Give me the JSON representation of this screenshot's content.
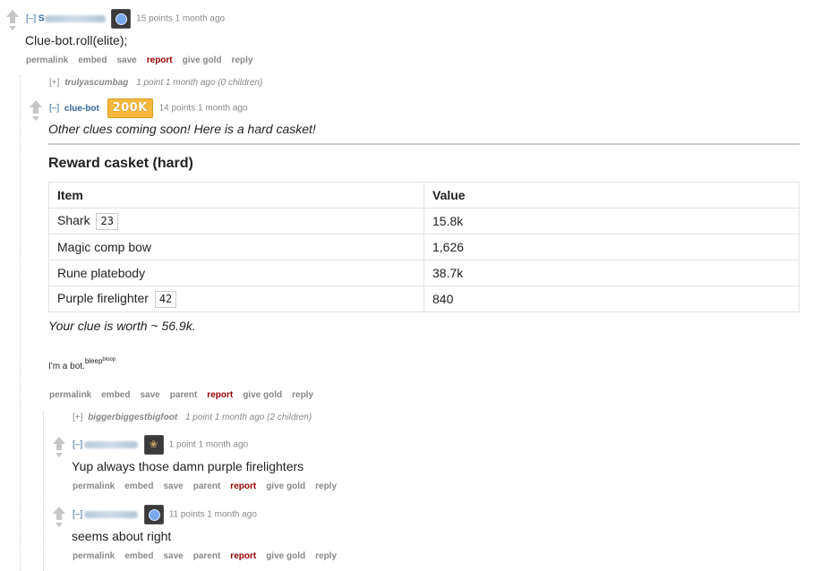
{
  "comment1": {
    "toggle": "[–]",
    "author_initial": "S",
    "score_time": "15 points 1 month ago",
    "body": "Clue-bot.roll(elite);",
    "buttons": [
      "permalink",
      "embed",
      "save",
      "report",
      "give gold",
      "reply"
    ]
  },
  "collapsed1": {
    "toggle": "[+]",
    "author": "trulyascumbag",
    "meta": "1 point 1 month ago (0 children)"
  },
  "cluebot": {
    "toggle": "[–]",
    "author": "clue-bot",
    "badge": "200K",
    "score_time": "14 points 1 month ago",
    "intro": "Other clues coming soon! Here is a hard casket!",
    "heading": "Reward casket (hard)",
    "table": {
      "headers": [
        "Item",
        "Value"
      ],
      "rows": [
        {
          "item": "Shark",
          "qty": "23",
          "value": "15.8k"
        },
        {
          "item": "Magic comp bow",
          "qty": "",
          "value": "1,626"
        },
        {
          "item": "Rune platebody",
          "qty": "",
          "value": "38.7k"
        },
        {
          "item": "Purple firelighter",
          "qty": "42",
          "value": "840"
        }
      ]
    },
    "worth": "Your clue is worth ~ 56.9k.",
    "footer_main": "I'm a bot.",
    "footer_sup1": "bleep",
    "footer_sup2": "bloop",
    "buttons": [
      "permalink",
      "embed",
      "save",
      "parent",
      "report",
      "give gold",
      "reply"
    ]
  },
  "collapsed2": {
    "toggle": "[+]",
    "author": "biggerbiggestbigfoot",
    "meta": "1 point 1 month ago (2 children)"
  },
  "reply1": {
    "toggle": "[–]",
    "score_time": "1 point 1 month ago",
    "body": "Yup always those damn purple firelighters",
    "buttons": [
      "permalink",
      "embed",
      "save",
      "parent",
      "report",
      "give gold",
      "reply"
    ]
  },
  "reply2": {
    "toggle": "[–]",
    "score_time": "11 points 1 month ago",
    "body": "seems about right",
    "buttons": [
      "permalink",
      "embed",
      "save",
      "parent",
      "report",
      "give gold",
      "reply"
    ]
  },
  "icons": {
    "flair_compass": "compass-flair-icon",
    "flair_paw": "paw-flair-icon",
    "upvote": "upvote-arrow-icon",
    "downvote": "downvote-arrow-icon"
  },
  "colors": {
    "link_blue": "#336699",
    "report_red": "#990000",
    "badge_gold": "#f5b83b"
  }
}
